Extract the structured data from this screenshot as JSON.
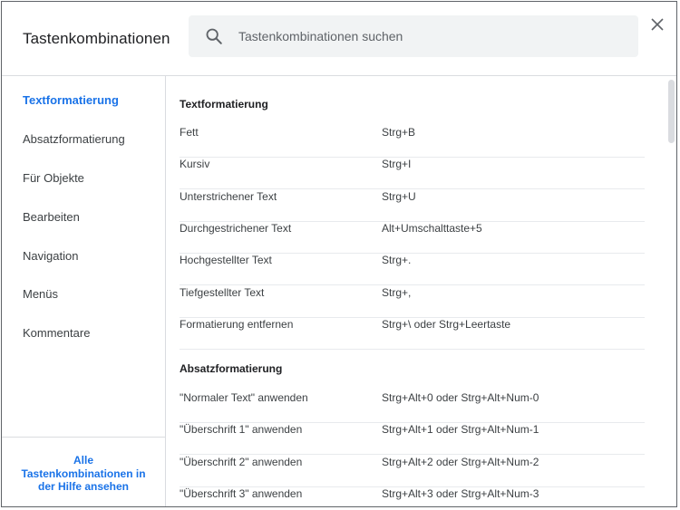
{
  "dialog": {
    "title": "Tastenkombinationen"
  },
  "search": {
    "placeholder": "Tastenkombinationen suchen"
  },
  "icons": {
    "search": "search-icon",
    "close": "close-icon"
  },
  "sidebar": {
    "items": [
      {
        "label": "Textformatierung",
        "active": true
      },
      {
        "label": "Absatzformatierung",
        "active": false
      },
      {
        "label": "Für Objekte",
        "active": false
      },
      {
        "label": "Bearbeiten",
        "active": false
      },
      {
        "label": "Navigation",
        "active": false
      },
      {
        "label": "Menüs",
        "active": false
      },
      {
        "label": "Kommentare",
        "active": false
      }
    ],
    "help_link": {
      "line1": "Alle",
      "line2": "Tastenkombinationen in",
      "line3": "der Hilfe ansehen"
    }
  },
  "sections": [
    {
      "title": "Textformatierung",
      "rows": [
        {
          "name": "Fett",
          "keys": "Strg+B"
        },
        {
          "name": "Kursiv",
          "keys": "Strg+I"
        },
        {
          "name": "Unterstrichener Text",
          "keys": "Strg+U"
        },
        {
          "name": "Durchgestrichener Text",
          "keys": "Alt+Umschalttaste+5"
        },
        {
          "name": "Hochgestellter Text",
          "keys": "Strg+."
        },
        {
          "name": "Tiefgestellter Text",
          "keys": "Strg+,"
        },
        {
          "name": "Formatierung entfernen",
          "keys": "Strg+\\ oder Strg+Leertaste"
        }
      ]
    },
    {
      "title": "Absatzformatierung",
      "rows": [
        {
          "name": "\"Normaler Text\" anwenden",
          "keys": "Strg+Alt+0 oder Strg+Alt+Num-0"
        },
        {
          "name": "\"Überschrift 1\" anwenden",
          "keys": "Strg+Alt+1 oder Strg+Alt+Num-1"
        },
        {
          "name": "\"Überschrift 2\" anwenden",
          "keys": "Strg+Alt+2 oder Strg+Alt+Num-2"
        },
        {
          "name": "\"Überschrift 3\" anwenden",
          "keys": "Strg+Alt+3 oder Strg+Alt+Num-3"
        }
      ]
    }
  ],
  "colors": {
    "accent": "#1a73e8",
    "divider": "#dadce0",
    "search_bg": "#f1f3f4"
  }
}
